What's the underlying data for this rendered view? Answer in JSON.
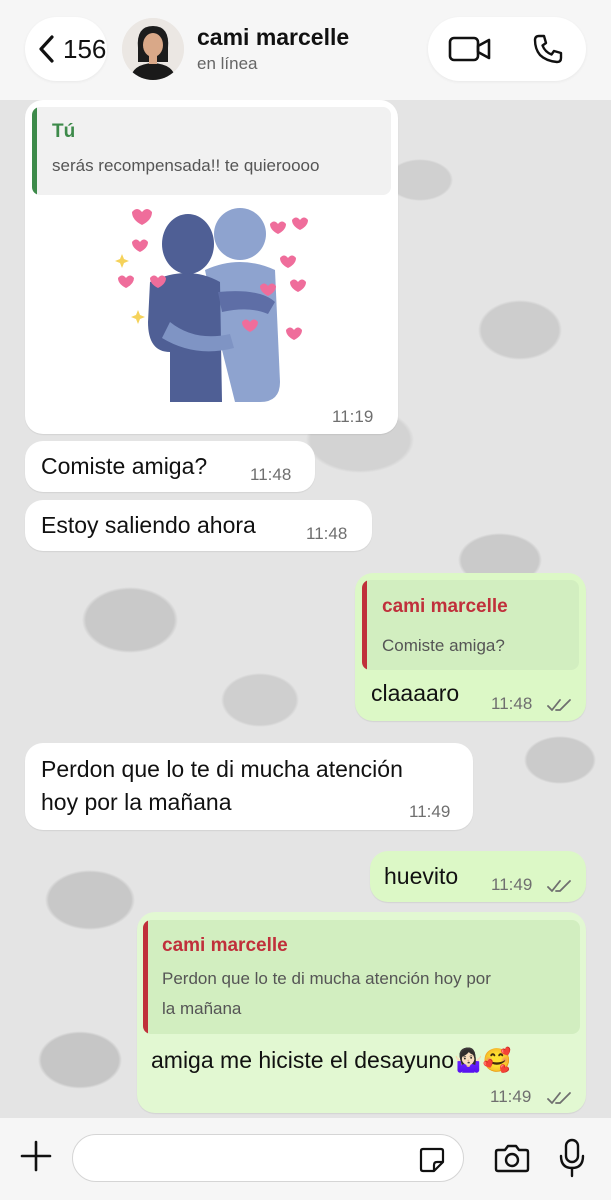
{
  "header": {
    "back_count": "156",
    "contact_name": "cami marcelle",
    "status": "en línea",
    "icons": [
      "chevron-left-icon",
      "video-call-icon",
      "phone-icon"
    ]
  },
  "messages": [
    {
      "direction": "in",
      "quote": {
        "author": "Tú",
        "text": "serás recompensada!! te quieroooo"
      },
      "sticker": "hug-sticker",
      "time": "11:19"
    },
    {
      "direction": "in",
      "text": "Comiste amiga?",
      "time": "11:48"
    },
    {
      "direction": "in",
      "text": "Estoy saliendo ahora",
      "time": "11:48"
    },
    {
      "direction": "out",
      "quote": {
        "author": "cami marcelle",
        "text": "Comiste amiga?"
      },
      "text": "claaaaro",
      "time": "11:48"
    },
    {
      "direction": "in",
      "text_line1": "Perdon que lo te di mucha atención",
      "text_line2": "hoy por la mañana",
      "time": "11:49"
    },
    {
      "direction": "out",
      "text": "huevito",
      "time": "11:49"
    },
    {
      "direction": "out",
      "quote": {
        "author": "cami marcelle",
        "text_line1": "Perdon que lo te di mucha atención hoy por",
        "text_line2": "la mañana"
      },
      "text": "amiga me hiciste el desayuno🤷🏻‍♀️🥰",
      "time": "11:49"
    }
  ],
  "composer": {
    "placeholder": "",
    "icons": [
      "plus-icon",
      "sticker-icon",
      "camera-icon",
      "microphone-icon"
    ]
  },
  "colors": {
    "outgoing_bubble": "#dcf8c6",
    "incoming_bubble": "#ffffff",
    "quote_self": "#3d8a4a",
    "quote_contact": "#c0303b",
    "read_ticks": "#6f6f6f"
  }
}
